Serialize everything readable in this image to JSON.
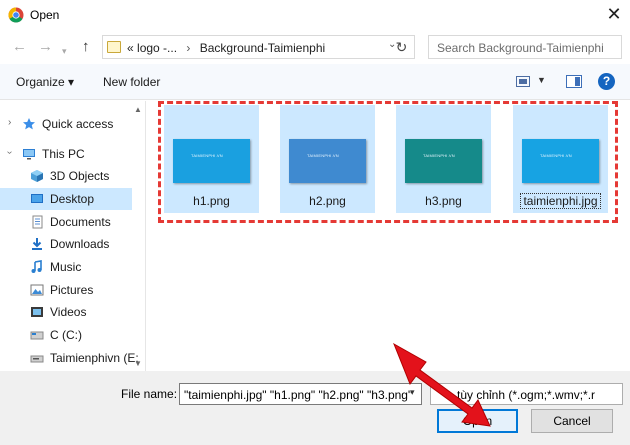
{
  "window": {
    "title": "Open"
  },
  "nav": {
    "crumb_prefix": "«",
    "crumb_1": "logo -...",
    "crumb_sep": "›",
    "crumb_2": "Background-Taimienphi",
    "search_placeholder": "Search Background-Taimienphi"
  },
  "toolbar": {
    "organize": "Organize ▾",
    "new_folder": "New folder",
    "help": "?"
  },
  "sidebar": {
    "items": [
      {
        "label": "Quick access",
        "icon": "star-icon"
      },
      {
        "label": "This PC",
        "icon": "computer-icon"
      },
      {
        "label": "3D Objects",
        "icon": "cube-icon"
      },
      {
        "label": "Desktop",
        "icon": "desktop-icon"
      },
      {
        "label": "Documents",
        "icon": "documents-icon"
      },
      {
        "label": "Downloads",
        "icon": "downloads-icon"
      },
      {
        "label": "Music",
        "icon": "music-icon"
      },
      {
        "label": "Pictures",
        "icon": "pictures-icon"
      },
      {
        "label": "Videos",
        "icon": "videos-icon"
      },
      {
        "label": "C (C:)",
        "icon": "drive-icon"
      },
      {
        "label": "Taimienphivn (E:",
        "icon": "drive-icon"
      }
    ],
    "selected": "Desktop"
  },
  "files": [
    {
      "name": "h1.png",
      "color": "#1aa0e0",
      "thumb_text": "TAIMIENPHI.VN"
    },
    {
      "name": "h2.png",
      "color": "#3f8ad0",
      "thumb_text": "TAIMIENPHI.VN"
    },
    {
      "name": "h3.png",
      "color": "#158a8a",
      "thumb_text": "TAIMIENPHI.VN"
    },
    {
      "name": "taimienphi.jpg",
      "color": "#17a3e3",
      "thumb_text": "TAIMIENPHI.VN"
    }
  ],
  "footer": {
    "file_name_label": "File name:",
    "file_name_value": "\"taimienphi.jpg\" \"h1.png\" \"h2.png\" \"h3.png\"",
    "file_type_value": "tùy chỉnh (*.ogm;*.wmv;*.r",
    "open_label": "Open",
    "cancel_label": "Cancel"
  },
  "colors": {
    "selection": "#cce8ff",
    "highlight_border": "#e53935",
    "accent": "#0078d7"
  }
}
